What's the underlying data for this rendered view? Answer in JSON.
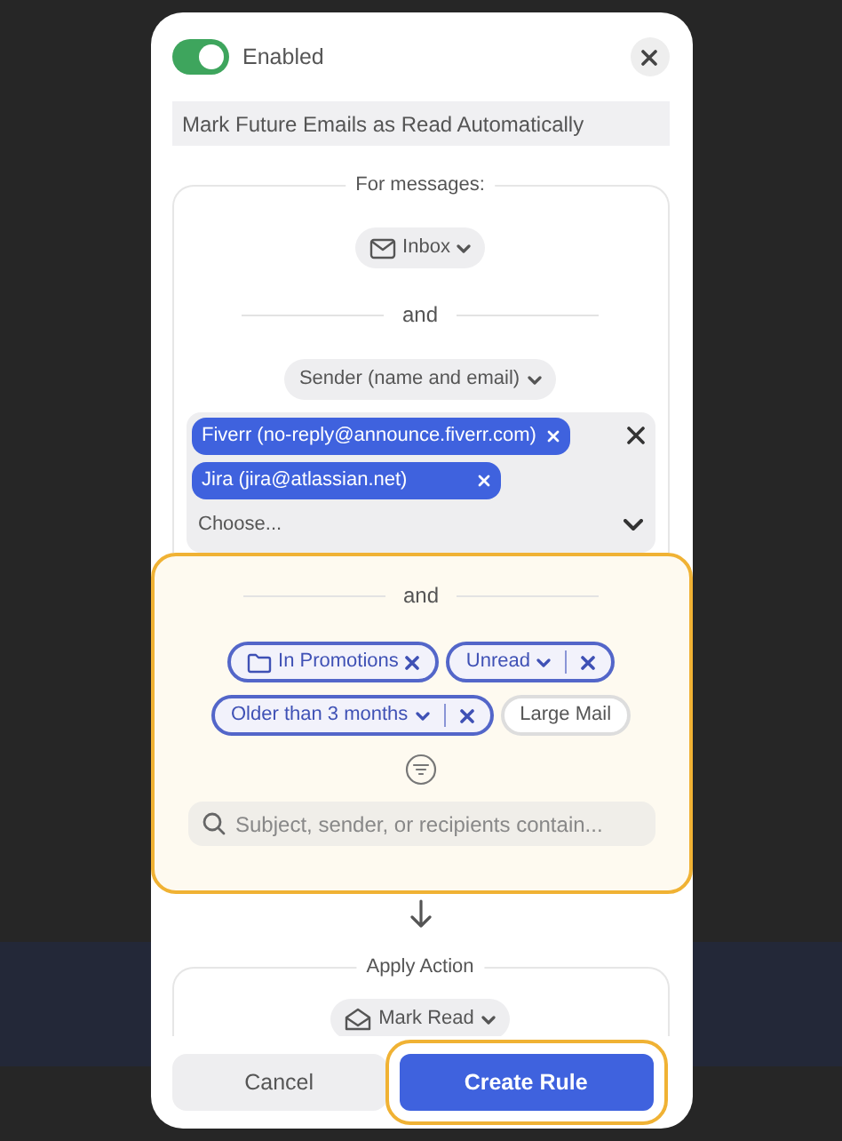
{
  "toggle": {
    "label": "Enabled",
    "on": true
  },
  "rule_name": {
    "value": "Mark Future Emails as Read Automatically"
  },
  "conditions": {
    "legend": "For messages:",
    "mailbox": "Inbox",
    "connector": "and",
    "field": "Sender (name and email)",
    "placeholder": "Choose...",
    "senders": [
      {
        "label": "Fiverr (no-reply@announce.fiverr.com)"
      },
      {
        "label": "Jira (jira@atlassian.net)"
      }
    ]
  },
  "filters": {
    "highlighted": true,
    "connector": "and",
    "search_placeholder": "Subject, sender, or recipients contain...",
    "rows": [
      [
        {
          "label": "In Promotions",
          "kind": "folder",
          "selected": true
        },
        {
          "label": "Unread",
          "kind": "dropdown",
          "selected": true
        }
      ],
      [
        {
          "label": "Older than 3 months",
          "kind": "dropdown",
          "selected": true
        },
        {
          "label": "Large Mail",
          "kind": "plain",
          "selected": false
        }
      ]
    ]
  },
  "action": {
    "legend": "Apply Action",
    "value": "Mark Read"
  },
  "buttons": [
    {
      "label": "Cancel",
      "kind": "secondary",
      "highlighted": false
    },
    {
      "label": "Create Rule",
      "kind": "primary",
      "highlighted": true
    }
  ]
}
